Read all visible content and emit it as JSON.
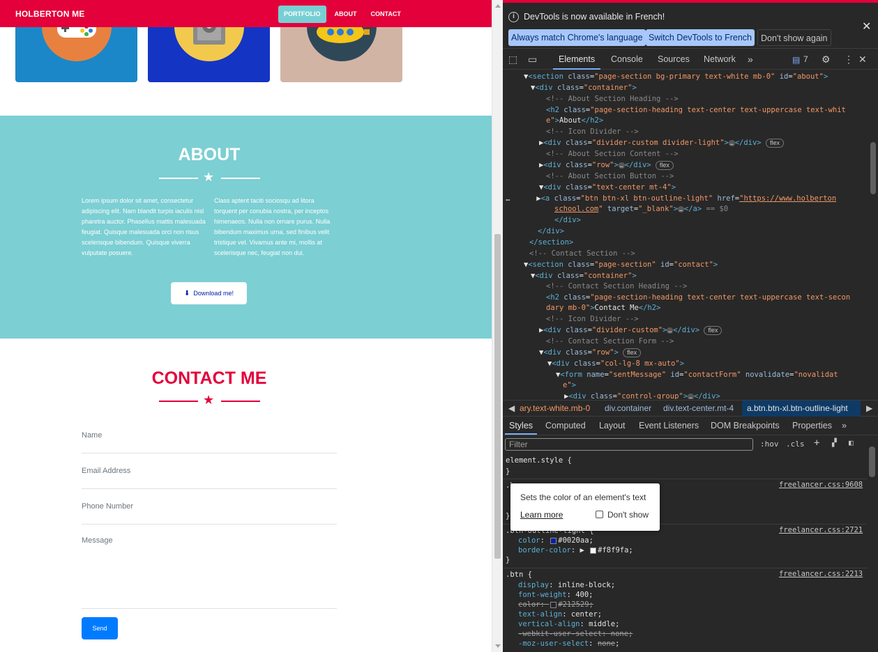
{
  "site": {
    "brand": "HOLBERTON ME",
    "nav": [
      "PORTFOLIO",
      "ABOUT",
      "CONTACT"
    ],
    "about": {
      "title": "ABOUT",
      "col1": "Lorem ipsum dolor sit amet, consectetur adipiscing elit. Nam blandit turpis iaculis nisl pharetra auctor. Phasellus mattis malesuada feugiat. Quisque malesuada orci non risus scelerisque bibendum. Quisque viverra vulputate posuere.",
      "col2": "Class aptent taciti sociosqu ad litora torquent per conubia nostra, per inceptos himenaeos. Nulla non ornare purus. Nulla bibendum maximus urna, sed finibus velit tristique vel. Vivamus ante mi, mollis at scelerisque nec, feugiat non dui.",
      "button": "Download me!"
    },
    "contact": {
      "title": "CONTACT ME",
      "fields": [
        "Name",
        "Email Address",
        "Phone Number",
        "Message"
      ],
      "send": "Send"
    },
    "colors": {
      "primary": "#e3003b",
      "teal": "#7ccfd3",
      "send": "#007bff"
    }
  },
  "devtools": {
    "info": {
      "message": "DevTools is now available in French!",
      "btn1": "Always match Chrome's language",
      "btn2": "Switch DevTools to French",
      "btn3": "Don't show again"
    },
    "tabs": [
      "Elements",
      "Console",
      "Sources",
      "Network"
    ],
    "issues_count": "7",
    "breadcrumbs": [
      "ary.text-white.mb-0",
      "div.container",
      "div.text-center.mt-4",
      "a.btn.btn-xl.btn-outline-light"
    ],
    "style_tabs": [
      "Styles",
      "Computed",
      "Layout",
      "Event Listeners",
      "DOM Breakpoints",
      "Properties"
    ],
    "filter_placeholder": "Filter",
    "hov": ":hov",
    "cls": ".cls",
    "tooltip": {
      "text": "Sets the color of an element's text",
      "learn": "Learn more",
      "dont": "Don't show"
    },
    "sources": [
      "freelancer.css:9608",
      "freelancer.css:2721",
      "freelancer.css:2213"
    ]
  }
}
